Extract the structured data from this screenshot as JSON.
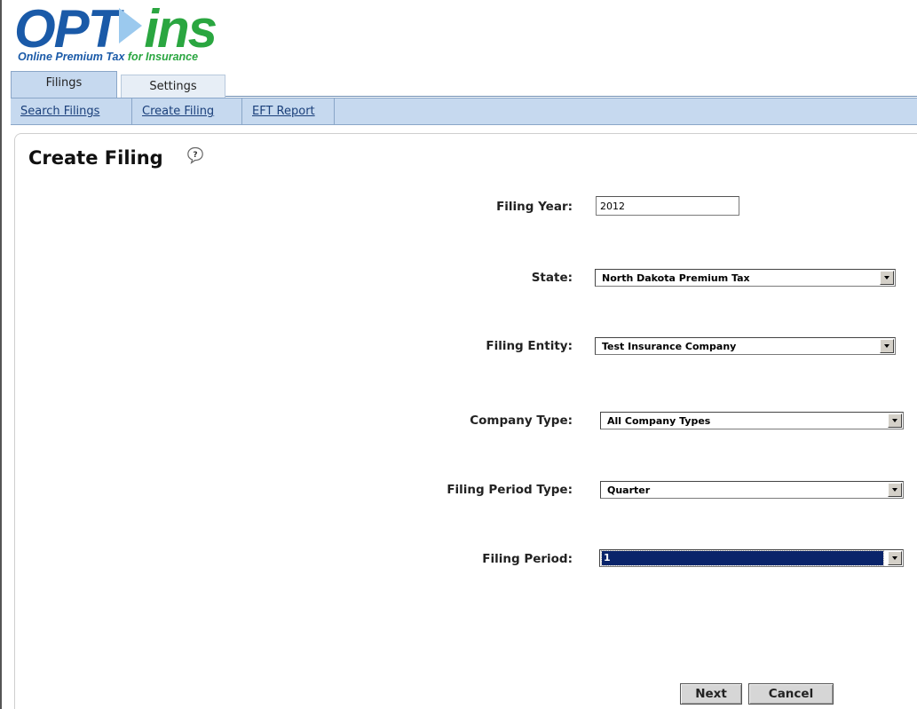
{
  "logo": {
    "word_left": "OPT",
    "word_right": "ins",
    "tagline_main": "Online Premium Tax",
    "tagline_for": "for Insurance"
  },
  "tabs": [
    {
      "label": "Filings",
      "active": true
    },
    {
      "label": "Settings",
      "active": false
    }
  ],
  "subnav": [
    {
      "label": "Search Filings"
    },
    {
      "label": "Create Filing"
    },
    {
      "label": "EFT Report"
    }
  ],
  "page": {
    "title": "Create Filing",
    "help_icon": "help-question-icon"
  },
  "form": {
    "filing_year": {
      "label": "Filing Year:",
      "value": "2012"
    },
    "state": {
      "label": "State:",
      "value": "North Dakota Premium Tax"
    },
    "filing_entity": {
      "label": "Filing Entity:",
      "value": "Test Insurance Company"
    },
    "company_type": {
      "label": "Company Type:",
      "value": "All Company Types"
    },
    "filing_period_type": {
      "label": "Filing Period Type:",
      "value": "Quarter"
    },
    "filing_period": {
      "label": "Filing Period:",
      "value": "1"
    }
  },
  "buttons": {
    "next": "Next",
    "cancel": "Cancel"
  },
  "colors": {
    "brand_blue": "#1a5aa8",
    "brand_green": "#2aa640",
    "nav_bar": "#c6d9ef",
    "selection": "#0a246a"
  }
}
